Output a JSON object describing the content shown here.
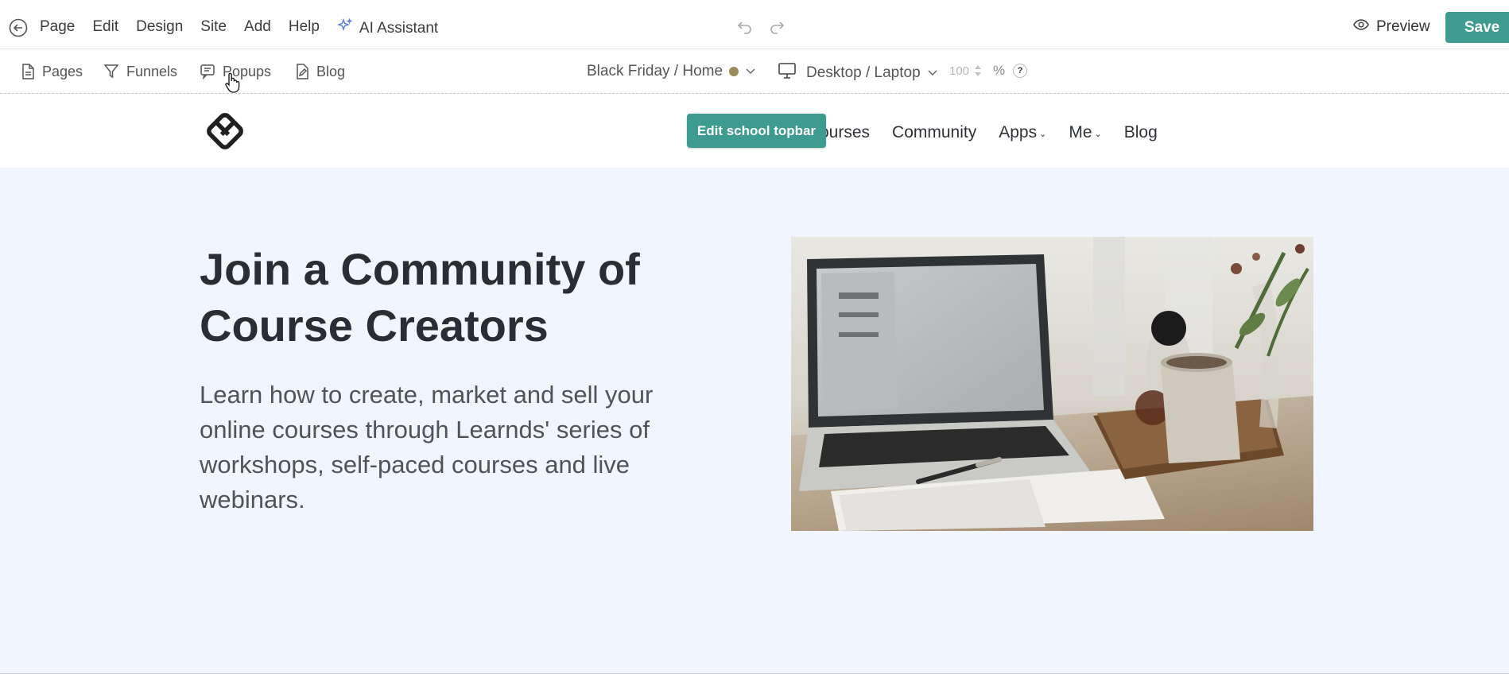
{
  "topbar": {
    "menu": [
      "Page",
      "Edit",
      "Design",
      "Site",
      "Add",
      "Help"
    ],
    "ai_assistant": "AI Assistant",
    "preview": "Preview",
    "save": "Save"
  },
  "toolbar": {
    "tabs": [
      "Pages",
      "Funnels",
      "Popups",
      "Blog"
    ],
    "page_select": "Black Friday / Home",
    "device_select": "Desktop / Laptop",
    "zoom_value": "100",
    "zoom_unit": "%",
    "help": "?"
  },
  "site": {
    "nav": {
      "items": [
        "Courses",
        "Community",
        "Apps",
        "Me",
        "Blog"
      ],
      "visible_first": "ourses"
    },
    "edit_topbar": "Edit school topbar"
  },
  "hero": {
    "title": "Join a Community of Course Creators",
    "subtitle": "Learn how to create, market and sell your online courses through Learnds' series of workshops, self-paced courses and live webinars."
  },
  "colors": {
    "accent": "#3e9b8f",
    "hero_bg": "#f1f5fd",
    "status_dot": "#9a8a5b"
  }
}
